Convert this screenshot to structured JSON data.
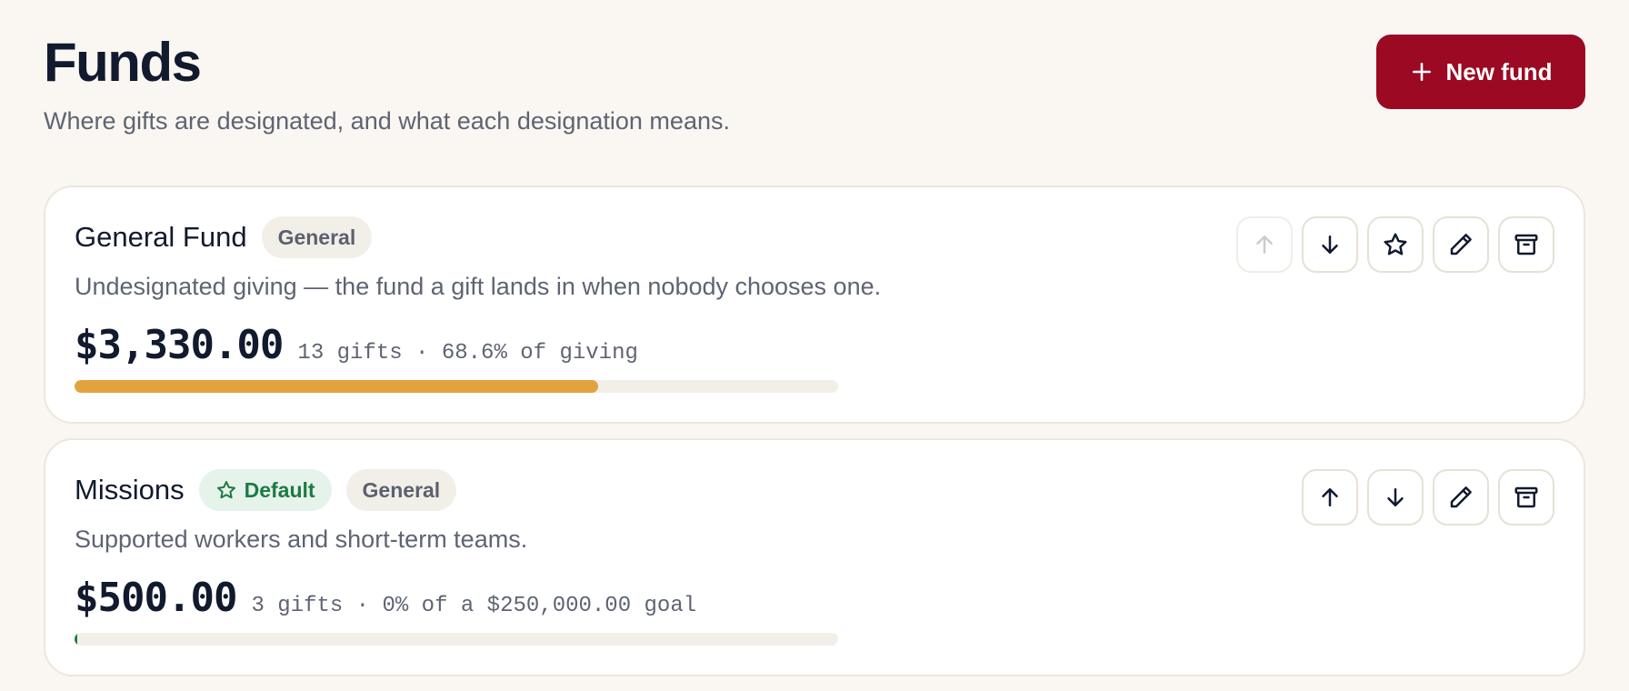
{
  "header": {
    "title": "Funds",
    "subtitle": "Where gifts are designated, and what each designation means."
  },
  "new_fund_button": {
    "label": "New fund",
    "icon": "plus-icon",
    "color": "#9b0a22"
  },
  "funds": [
    {
      "name": "General Fund",
      "tags": [
        "General"
      ],
      "description": "Undesignated giving — the fund a gift lands in when nobody chooses one.",
      "amount": "$3,330.00",
      "meta": "13 gifts · 68.6% of giving",
      "progress": 0.686,
      "progress_color": "#e2a33f",
      "actions": [
        {
          "icon": "arrow-up-icon",
          "disabled": true
        },
        {
          "icon": "arrow-down-icon",
          "disabled": false
        },
        {
          "icon": "star-icon",
          "disabled": false
        },
        {
          "icon": "pencil-icon",
          "disabled": false
        },
        {
          "icon": "archive-icon",
          "disabled": false
        }
      ]
    },
    {
      "name": "Missions",
      "default_badge": "Default",
      "tags": [
        "General"
      ],
      "description": "Supported workers and short-term teams.",
      "amount": "$500.00",
      "meta": "3 gifts · 0% of a $250,000.00 goal",
      "progress": 0,
      "progress_color": "#1d7a45",
      "actions": [
        {
          "icon": "arrow-up-icon",
          "disabled": false
        },
        {
          "icon": "arrow-down-icon",
          "disabled": false
        },
        {
          "icon": "pencil-icon",
          "disabled": false
        },
        {
          "icon": "archive-icon",
          "disabled": false
        }
      ]
    }
  ],
  "colors": {
    "background": "#faf7f2",
    "card": "#ffffff",
    "text_dark": "#111a2e",
    "text_muted": "#5e6472",
    "default_badge_bg": "#e6f3ea",
    "default_badge_text": "#1d7a45"
  }
}
